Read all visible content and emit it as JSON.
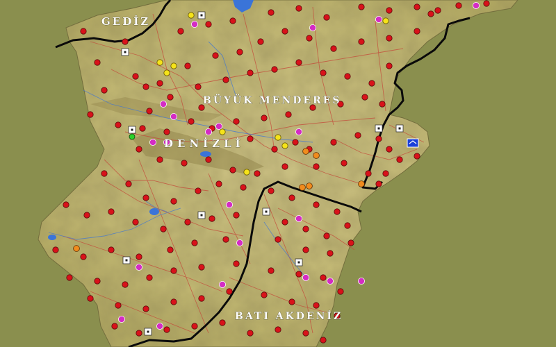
{
  "map": {
    "region_labels": {
      "gediz": "GEDİZ",
      "buyuk_menderes": "BÜYÜK MENDERES",
      "bati_akdeniz": "BATI AKDENİZ"
    },
    "city_label": "DENİZLİ",
    "colors": {
      "background": "#8a8f4e",
      "terrain": "#c9be7a",
      "boundary": "#0a0a0a",
      "red_marker": "#d8121a",
      "magenta_marker": "#d42cc4",
      "orange_marker": "#f08c1e",
      "yellow_marker": "#f5e31a",
      "water": "#3a74d8"
    },
    "legend_icons": [
      "red-dot-icon",
      "magenta-dot-icon",
      "orange-dot-icon",
      "yellow-dot-icon",
      "white-square-icon",
      "blue-symbol-icon"
    ]
  }
}
